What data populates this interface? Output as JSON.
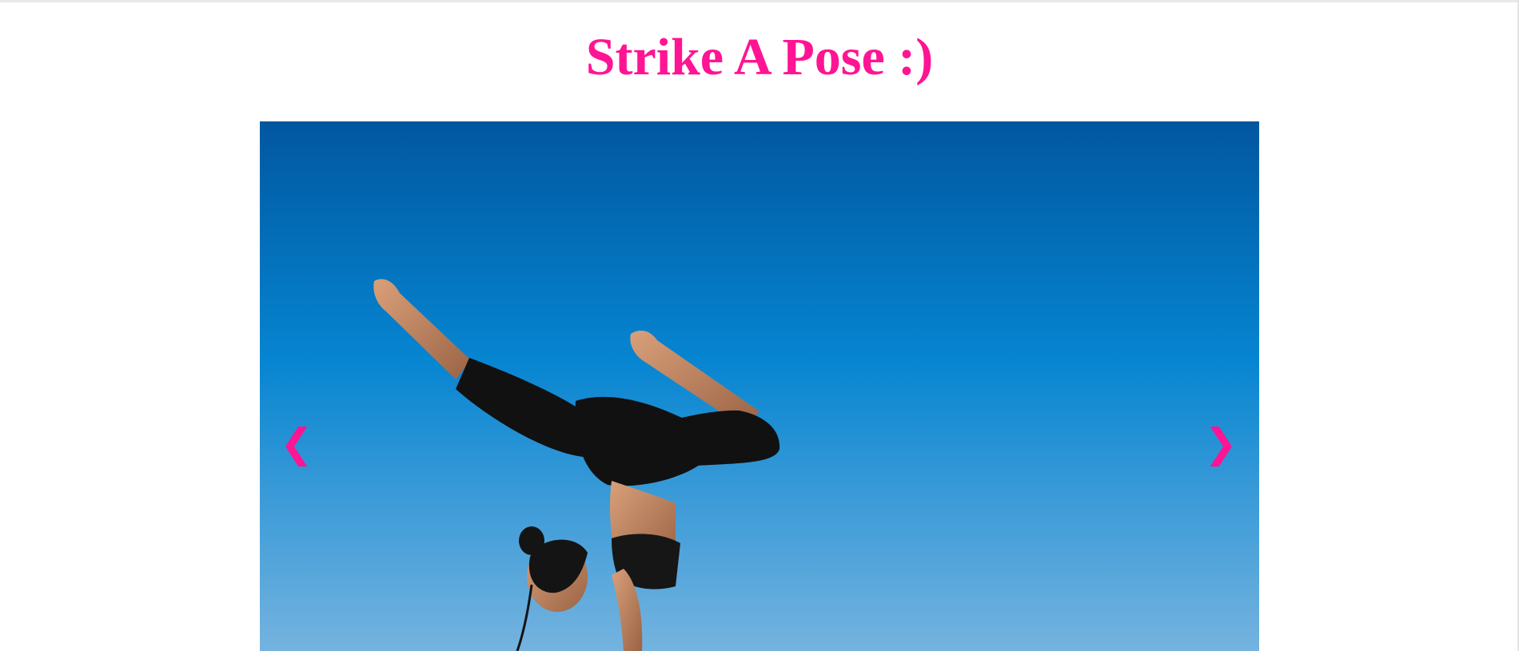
{
  "page": {
    "title": "Strike A Pose :)"
  },
  "slideshow": {
    "prev_label": "❮",
    "next_label": "❯",
    "accent_color": "#ff1493",
    "sky_top_color": "#0157a0",
    "sky_bottom_color": "#75b3df"
  }
}
